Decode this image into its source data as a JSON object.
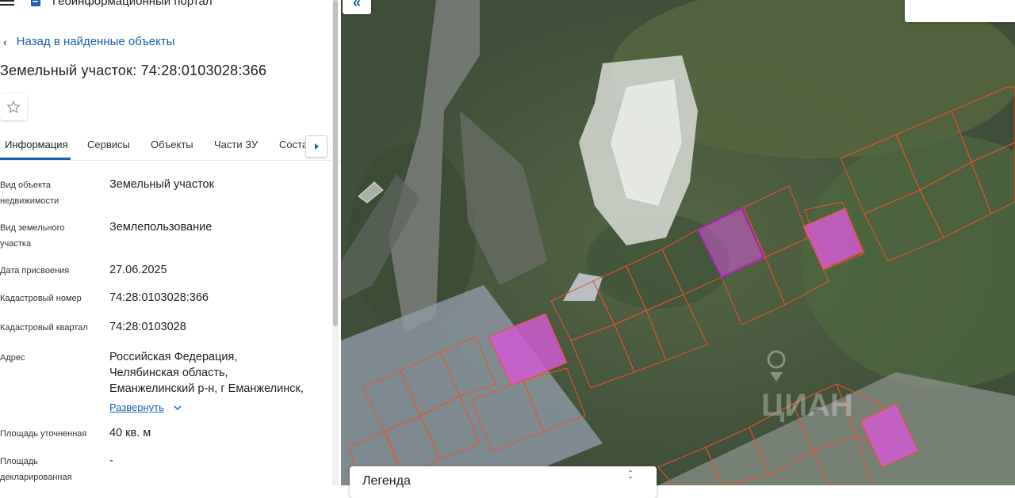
{
  "header": {
    "portal_title": "Геоинформационный портал"
  },
  "nav": {
    "back_label": "Назад в найденные объекты"
  },
  "object": {
    "title": "Земельный участок: 74:28:0103028:366"
  },
  "tabs": [
    {
      "label": "Информация",
      "active": true
    },
    {
      "label": "Сервисы",
      "active": false
    },
    {
      "label": "Объекты",
      "active": false
    },
    {
      "label": "Части ЗУ",
      "active": false
    },
    {
      "label": "Соста",
      "active": false
    }
  ],
  "details": {
    "object_type_label_1": "Вид объекта",
    "object_type_label_2": "недвижимости",
    "object_type_value": "Земельный участок",
    "land_type_label_1": "Вид земельного",
    "land_type_label_2": "участка",
    "land_type_value": "Землепользование",
    "date_label": "Дата присвоения",
    "date_value": "27.06.2025",
    "cadastral_number_label": "Кадастровый номер",
    "cadastral_number_value": "74:28:0103028:366",
    "cadastral_quarter_label": "Кадастровый квартал",
    "cadastral_quarter_value": "74:28:0103028",
    "address_label": "Адрес",
    "address_line_1": "Российская Федерация,",
    "address_line_2": "Челябинская область,",
    "address_line_3": "Еманжелинский р-н, г Еманжелинск,",
    "expand_label": "Развернуть",
    "area_precise_label": "Площадь уточненная",
    "area_precise_value": "40 кв. м",
    "area_declared_label_1": "Площадь",
    "area_declared_label_2": "декларированная",
    "area_declared_value": "-"
  },
  "map": {
    "legend_title": "Легенда",
    "watermark": "ЦИАН"
  },
  "colors": {
    "accent": "#1a5fb4",
    "parcel_border": "#e8542a",
    "parcel_selected_fill": "#d65ad6",
    "parcel_highlight_border": "#b020c0"
  }
}
